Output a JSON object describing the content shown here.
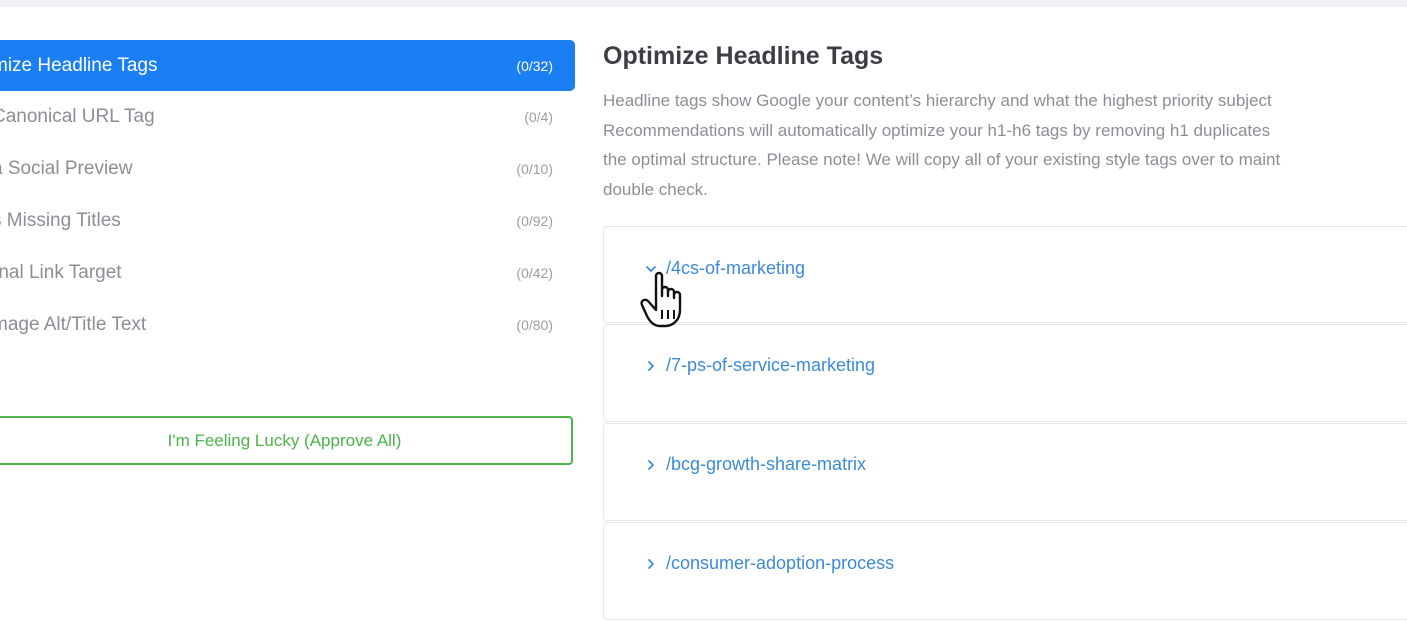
{
  "sidebar": {
    "items": [
      {
        "label": "mize Headline Tags",
        "count": "(0/32)",
        "active": true
      },
      {
        "label": " Canonical URL Tag",
        "count": "(0/4)"
      },
      {
        "label": "a Social Preview",
        "count": "(0/10)"
      },
      {
        "label": "s Missing Titles",
        "count": "(0/92)"
      },
      {
        "label": "rnal Link Target",
        "count": "(0/42)"
      },
      {
        "label": "mage Alt/Title Text",
        "count": "(0/80)"
      }
    ],
    "lucky_button": "I'm Feeling Lucky (Approve All)"
  },
  "main": {
    "title": "Optimize Headline Tags",
    "description": [
      "Headline tags show Google your content’s hierarchy and what the highest priority subject",
      "Recommendations will automatically optimize your h1-h6 tags by removing h1 duplicates",
      "the optimal structure. Please note! We will copy all of your existing style tags over to maint",
      "double check."
    ],
    "pages": [
      {
        "path": "/4cs-of-marketing",
        "expanded": true
      },
      {
        "path": "/7-ps-of-service-marketing",
        "expanded": false
      },
      {
        "path": "/bcg-growth-share-matrix",
        "expanded": false
      },
      {
        "path": "/consumer-adoption-process",
        "expanded": false
      }
    ]
  },
  "colors": {
    "active": "#1a7ff2",
    "link": "#3d8ad6",
    "success": "#4db34a",
    "muted_text": "#8b8f95"
  },
  "icons": {
    "expanded": "chevron-down-icon",
    "collapsed": "chevron-right-icon",
    "pointer": "hand-pointer-cursor-icon"
  }
}
